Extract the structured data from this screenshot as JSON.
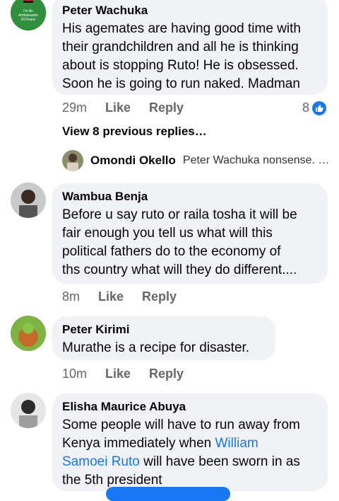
{
  "comments": [
    {
      "name": "Peter Wachuka",
      "text": "His agemates are having good time with\ntheir grandchildren and all he is thinking\nabout is stopping Ruto! He is obsessed.\nSoon he is going to run naked. Madman",
      "time": "29m",
      "like": "Like",
      "reply": "Reply",
      "reaction_count": "8",
      "avatar_text": "I'm An Ambassador Of Peace"
    },
    {
      "name": "Wambua Benja",
      "text": "Before u say ruto or raila tosha it will be\nfair enough you tell us what will this\npolitical fathers do to the economy of\nths country what will they do different....",
      "time": "8m",
      "like": "Like",
      "reply": "Reply"
    },
    {
      "name": "Peter Kirimi",
      "text": "Murathe is a recipe for disaster.",
      "time": "10m",
      "like": "Like",
      "reply": "Reply"
    },
    {
      "name": "Elisha Maurice Abuya",
      "text_before": "Some people will have to run away from\nKenya immediately when ",
      "mention": "William\nSamoei Ruto",
      "text_after": " will have been sworn in as\nthe 5th president"
    }
  ],
  "previous_replies": "View 8 previous replies…",
  "reply_preview": {
    "name": "Omondi Okello",
    "snippet": "Peter Wachuka nonsense. E..."
  },
  "colors": {
    "bubble": "#f0f2f5",
    "link": "#1877f2",
    "meta": "#65676b"
  },
  "icons": [
    "like-thumb-icon"
  ]
}
